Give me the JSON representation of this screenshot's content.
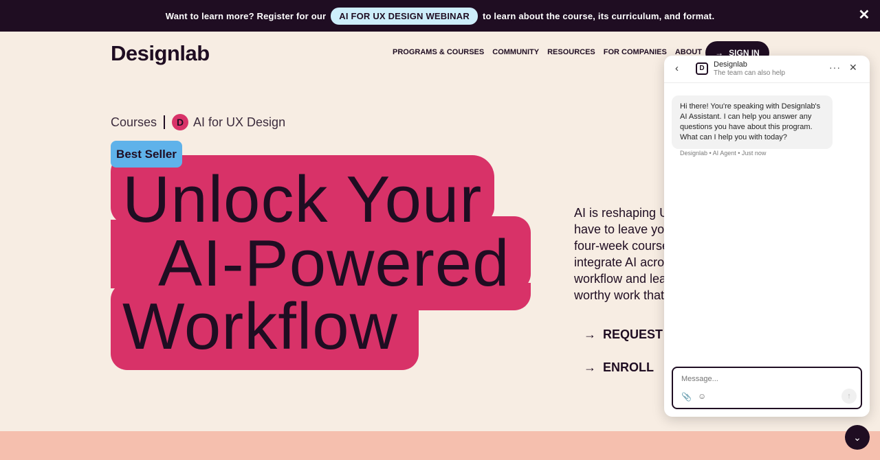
{
  "announcement": {
    "prefix": "Want to learn more? Register for our",
    "pill": "AI FOR UX DESIGN WEBINAR",
    "suffix": "to learn about the course, its curriculum, and format.",
    "close_icon": "close-icon"
  },
  "header": {
    "logo": "Designlab",
    "nav": [
      "PROGRAMS & COURSES",
      "COMMUNITY",
      "RESOURCES",
      "FOR COMPANIES",
      "ABOUT"
    ],
    "signin_label": "SIGN IN"
  },
  "breadcrumb": {
    "root": "Courses",
    "current": "AI for UX Design",
    "badge_letter": "D"
  },
  "hero": {
    "badge": "Best Seller",
    "line1": "Unlock Your",
    "line2": "AI-Powered",
    "line3": "Workflow",
    "description": [
      "AI is reshaping U",
      "have to leave you",
      "four-week course",
      "integrate AI acro",
      "workflow and leav",
      "worthy work that"
    ],
    "cta_request": "REQUEST S",
    "cta_enroll": "ENROLL"
  },
  "chat": {
    "title": "Designlab",
    "subtitle": "The team can also help",
    "message": "Hi there! You're speaking with Designlab's AI Assistant. I can help you answer any questions you have about this program. What can I help you with today?",
    "meta": "Designlab • AI Agent • Just now",
    "placeholder": "Message..."
  },
  "colors": {
    "dark": "#1f0d22",
    "accent_pink": "#d83268",
    "badge_blue": "#5fb2ea",
    "pill_blue": "#cdeefb",
    "background": "#f7ede3",
    "band": "#f5bfae"
  }
}
